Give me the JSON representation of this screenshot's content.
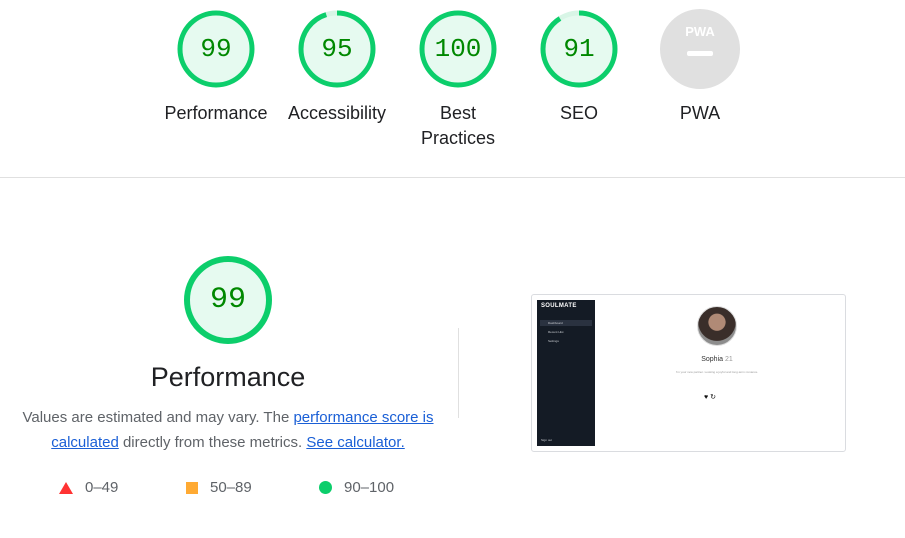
{
  "categories": [
    {
      "name": "performance",
      "label": "Performance",
      "score": 99
    },
    {
      "name": "accessibility",
      "label": "Accessibility",
      "score": 95
    },
    {
      "name": "best-practices",
      "label": "Best Practices",
      "score": 100
    },
    {
      "name": "seo",
      "label": "SEO",
      "score": 91
    },
    {
      "name": "pwa",
      "label": "PWA",
      "score": null,
      "badge_text": "PWA"
    }
  ],
  "performance_detail": {
    "score": 99,
    "title": "Performance",
    "desc_before": "Values are estimated and may vary. The ",
    "link_score": "performance score is calculated",
    "desc_middle": " directly from these metrics. ",
    "link_calculator": "See calculator."
  },
  "legend": [
    {
      "range": "0–49",
      "shape": "triangle",
      "color": "#ff3333"
    },
    {
      "range": "50–89",
      "shape": "square",
      "color": "#ffaa33"
    },
    {
      "range": "90–100",
      "shape": "circle",
      "color": "#0cce6b"
    }
  ],
  "screenshot": {
    "logo": "SOULMATE",
    "nav": [
      "Dashboard",
      "Recent Hist",
      "Settings"
    ],
    "signout": "Sign out",
    "profile_name": "Sophia",
    "profile_age": "21",
    "tagline": "I'm your new partner. Looking a joyful and long-term romance.",
    "actions": "♥ ↻"
  },
  "colors": {
    "pass": "#0cce6b",
    "pass_fill": "#e6faf0",
    "pass_text": "#008800",
    "na": "#e0e0e0"
  }
}
